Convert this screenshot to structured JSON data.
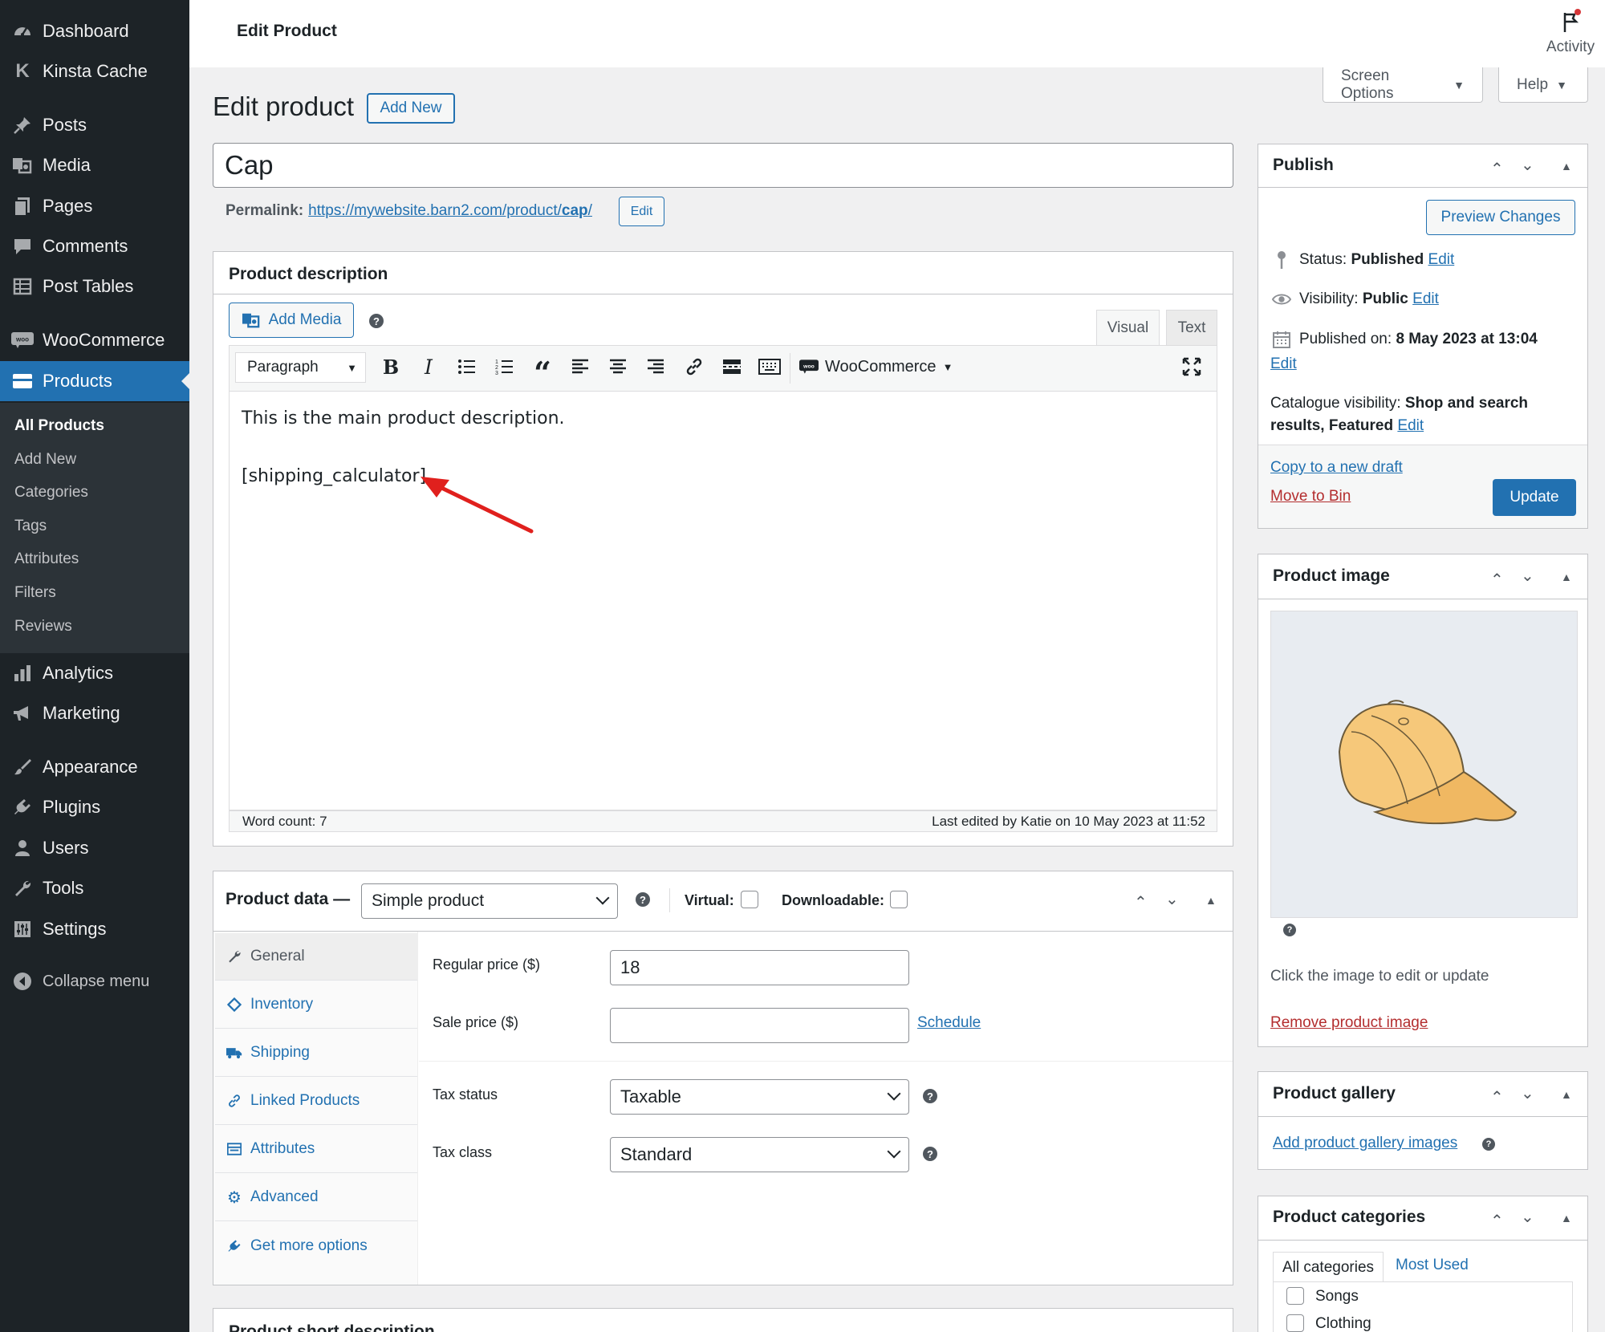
{
  "sidebar": {
    "items": [
      {
        "label": "Dashboard",
        "icon": "dashboard-icon"
      },
      {
        "label": "Kinsta Cache",
        "icon": "kinsta-icon"
      },
      {
        "label": "Posts",
        "icon": "pin-icon"
      },
      {
        "label": "Media",
        "icon": "media-icon"
      },
      {
        "label": "Pages",
        "icon": "pages-icon"
      },
      {
        "label": "Comments",
        "icon": "comments-icon"
      },
      {
        "label": "Post Tables",
        "icon": "table-icon"
      },
      {
        "label": "WooCommerce",
        "icon": "woo-icon"
      },
      {
        "label": "Products",
        "icon": "products-icon"
      },
      {
        "label": "Analytics",
        "icon": "analytics-icon"
      },
      {
        "label": "Marketing",
        "icon": "megaphone-icon"
      },
      {
        "label": "Appearance",
        "icon": "brush-icon"
      },
      {
        "label": "Plugins",
        "icon": "plugin-icon"
      },
      {
        "label": "Users",
        "icon": "user-icon"
      },
      {
        "label": "Tools",
        "icon": "wrench-icon"
      },
      {
        "label": "Settings",
        "icon": "settings-icon"
      },
      {
        "label": "Collapse menu",
        "icon": "collapse-icon"
      }
    ],
    "submenu": [
      "All Products",
      "Add New",
      "Categories",
      "Tags",
      "Attributes",
      "Filters",
      "Reviews"
    ]
  },
  "header": {
    "title": "Edit Product",
    "activity": "Activity",
    "screen_options": "Screen Options",
    "help": "Help"
  },
  "page": {
    "heading": "Edit product",
    "add_new": "Add New",
    "product_title": "Cap",
    "permalink_label": "Permalink:",
    "permalink_base": "https://mywebsite.barn2.com/product/",
    "permalink_slug": "cap",
    "permalink_end": "/",
    "permalink_edit": "Edit"
  },
  "description": {
    "title": "Product description",
    "add_media": "Add Media",
    "tab_visual": "Visual",
    "tab_text": "Text",
    "format": "Paragraph",
    "woocommerce": "WooCommerce",
    "line1": "This is the main product description.",
    "line2": "[shipping_calculator]",
    "word_count": "Word count: 7",
    "last_edited": "Last edited by Katie on 10 May 2023 at 11:52"
  },
  "product_data": {
    "title": "Product data —",
    "type": "Simple product",
    "virtual": "Virtual:",
    "downloadable": "Downloadable:",
    "tabs": [
      "General",
      "Inventory",
      "Shipping",
      "Linked Products",
      "Attributes",
      "Advanced",
      "Get more options"
    ],
    "regular_price_label": "Regular price ($)",
    "regular_price": "18",
    "sale_price_label": "Sale price ($)",
    "sale_price": "",
    "schedule": "Schedule",
    "tax_status_label": "Tax status",
    "tax_status": "Taxable",
    "tax_class_label": "Tax class",
    "tax_class": "Standard"
  },
  "short_description": {
    "title": "Product short description"
  },
  "publish": {
    "title": "Publish",
    "preview": "Preview Changes",
    "status_label": "Status:",
    "status_value": "Published",
    "visibility_label": "Visibility:",
    "visibility_value": "Public",
    "published_label": "Published on:",
    "published_value": "8 May 2023 at 13:04",
    "edit": "Edit",
    "catalogue_label": "Catalogue visibility:",
    "catalogue_value": "Shop and search results, Featured",
    "copy_draft": "Copy to a new draft",
    "move_bin": "Move to Bin",
    "update": "Update"
  },
  "product_image": {
    "title": "Product image",
    "hint": "Click the image to edit or update",
    "remove": "Remove product image"
  },
  "gallery": {
    "title": "Product gallery",
    "add": "Add product gallery images"
  },
  "categories": {
    "title": "Product categories",
    "tab_all": "All categories",
    "tab_used": "Most Used",
    "items": [
      "Songs",
      "Clothing"
    ]
  },
  "colors": {
    "sidebar_bg": "#1d2327",
    "accent": "#2271b1",
    "danger": "#b32d2e",
    "annotation_arrow": "#e0201d"
  }
}
